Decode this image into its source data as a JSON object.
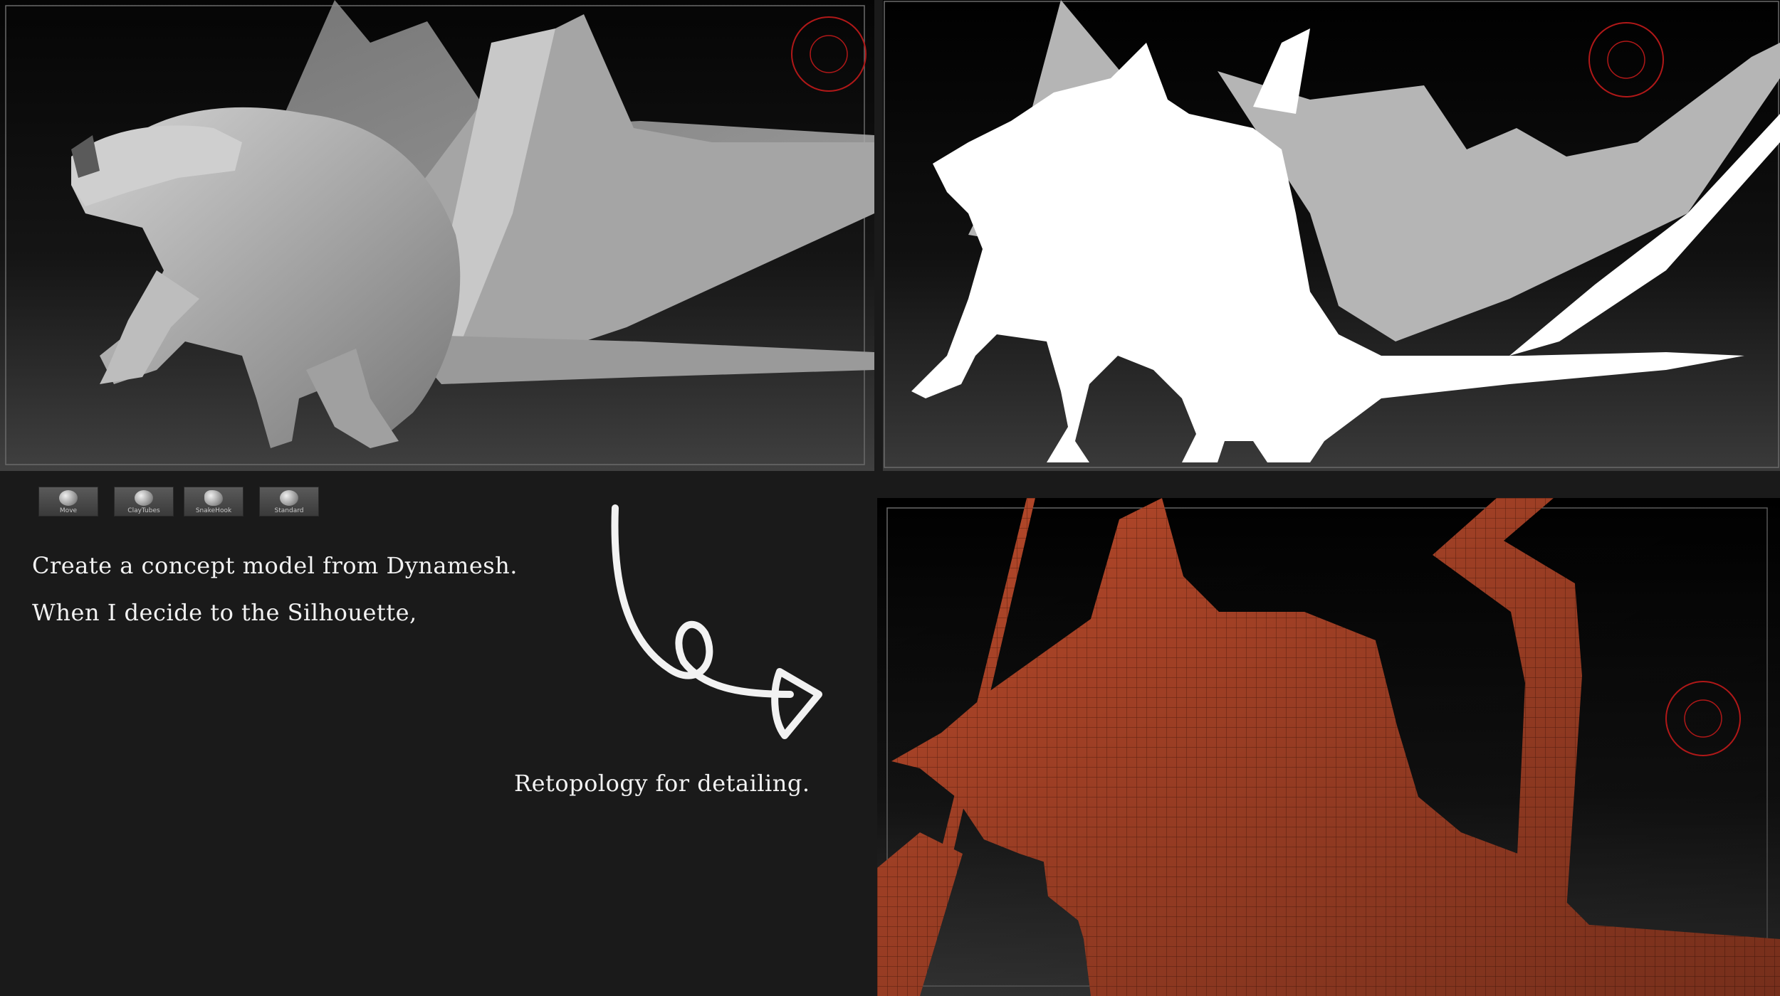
{
  "captions": {
    "line1": "Create a concept model from Dynamesh.",
    "line2": "When I decide to the Silhouette,",
    "line3": "Retopology for detailing."
  },
  "brushes": [
    {
      "label": "Move",
      "icon": "move-brush-icon"
    },
    {
      "label": "ClayTubes",
      "icon": "claytubes-brush-icon"
    },
    {
      "label": "SnakeHook",
      "icon": "snakehook-brush-icon"
    },
    {
      "label": "Standard",
      "icon": "standard-brush-icon"
    }
  ],
  "panels": {
    "sculpt": "grey-dragon-sculpt",
    "silhouette": "white-dragon-silhouette",
    "retopology": "orange-dragon-retopology-wireframe"
  },
  "colors": {
    "background": "#1a1a1a",
    "sculpt_surface": "#a8a8a8",
    "silhouette_body": "#ffffff",
    "silhouette_wing": "#b5b5b5",
    "retopo_surface": "#b54a2a",
    "gizmo_red": "#c01818"
  }
}
